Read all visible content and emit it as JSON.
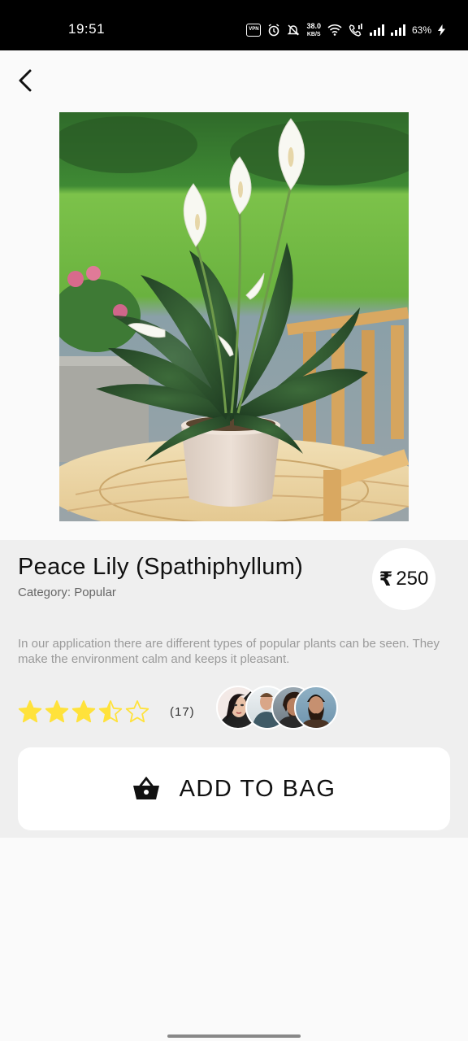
{
  "status_bar": {
    "time": "19:51",
    "vpn_label": "VPN",
    "net_speed_value": "38.0",
    "net_speed_unit": "KB/S",
    "battery": "63%",
    "icons": [
      "vpn-icon",
      "alarm-icon",
      "mute-icon",
      "wifi-icon",
      "call-icon",
      "signal-icon",
      "signal-icon",
      "charging-icon"
    ]
  },
  "nav": {
    "back_icon": "chevron-left-icon"
  },
  "product": {
    "image_subject": "peace-lily-plant-photo",
    "name": "Peace Lily (Spathiphyllum)",
    "category": "Category: Popular",
    "currency_symbol": "₹",
    "price": "250",
    "description": "In our application there are different types of popular plants can be seen. They make the environment calm and keeps it pleasant.",
    "rating": 3.5,
    "rating_max": 5,
    "rating_count": "(17)",
    "star_color": "#FFE23B"
  },
  "actions": {
    "add_to_bag_label": "ADD TO BAG",
    "bag_icon": "shopping-basket-icon"
  }
}
